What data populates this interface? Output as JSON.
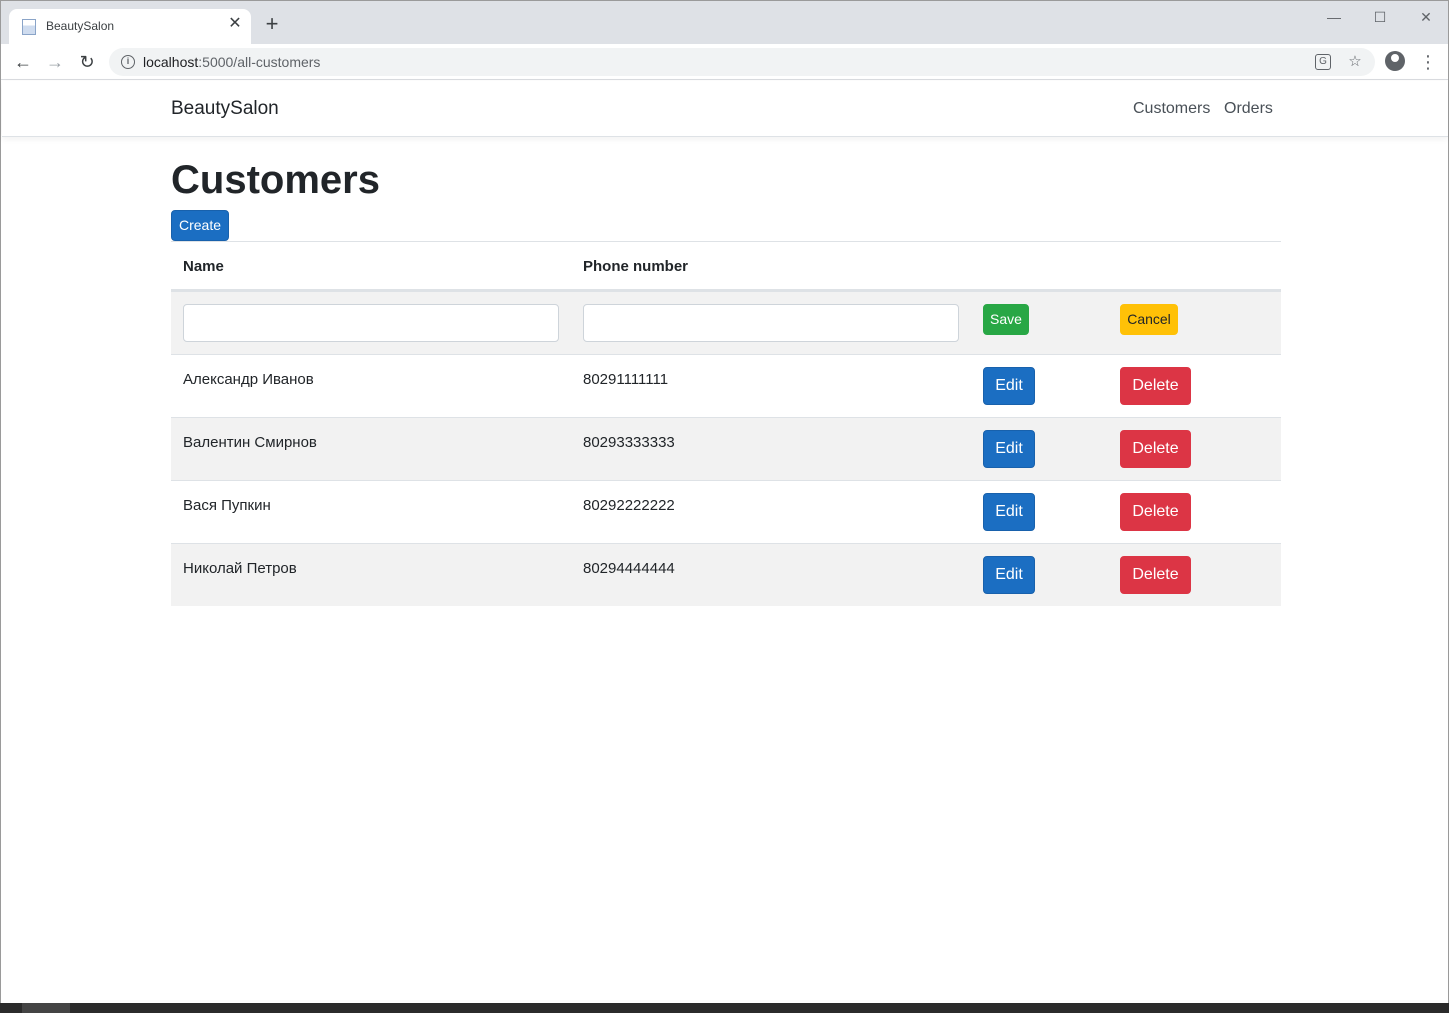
{
  "browser": {
    "tab_title": "BeautySalon",
    "tab_close": "✕",
    "new_tab": "+",
    "url_host": "localhost",
    "url_path": ":5000/all-customers",
    "window_controls": {
      "minimize": "—",
      "maximize": "☐",
      "close": "✕"
    },
    "nav": {
      "back": "←",
      "forward": "→",
      "reload": "↻"
    },
    "icons": {
      "info": "i",
      "translate": "G",
      "star": "☆",
      "menu": "⋮"
    }
  },
  "navbar": {
    "brand": "BeautySalon",
    "links": [
      "Customers",
      "Orders"
    ]
  },
  "main": {
    "title": "Customers",
    "create_label": "Create",
    "columns": [
      "Name",
      "Phone number"
    ],
    "edit_row": {
      "name_value": "",
      "phone_value": "",
      "save_label": "Save",
      "cancel_label": "Cancel"
    },
    "rows": [
      {
        "name": "Александр Иванов",
        "phone": "80291111111",
        "edit": "Edit",
        "delete": "Delete"
      },
      {
        "name": "Валентин Смирнов",
        "phone": "80293333333",
        "edit": "Edit",
        "delete": "Delete"
      },
      {
        "name": "Вася Пупкин",
        "phone": "80292222222",
        "edit": "Edit",
        "delete": "Delete"
      },
      {
        "name": "Николай Петров",
        "phone": "80294444444",
        "edit": "Edit",
        "delete": "Delete"
      }
    ]
  },
  "colors": {
    "primary": "#1b6ec2",
    "success": "#28a745",
    "warning": "#ffc107",
    "danger": "#dc3545",
    "stripe": "#f2f2f2"
  }
}
